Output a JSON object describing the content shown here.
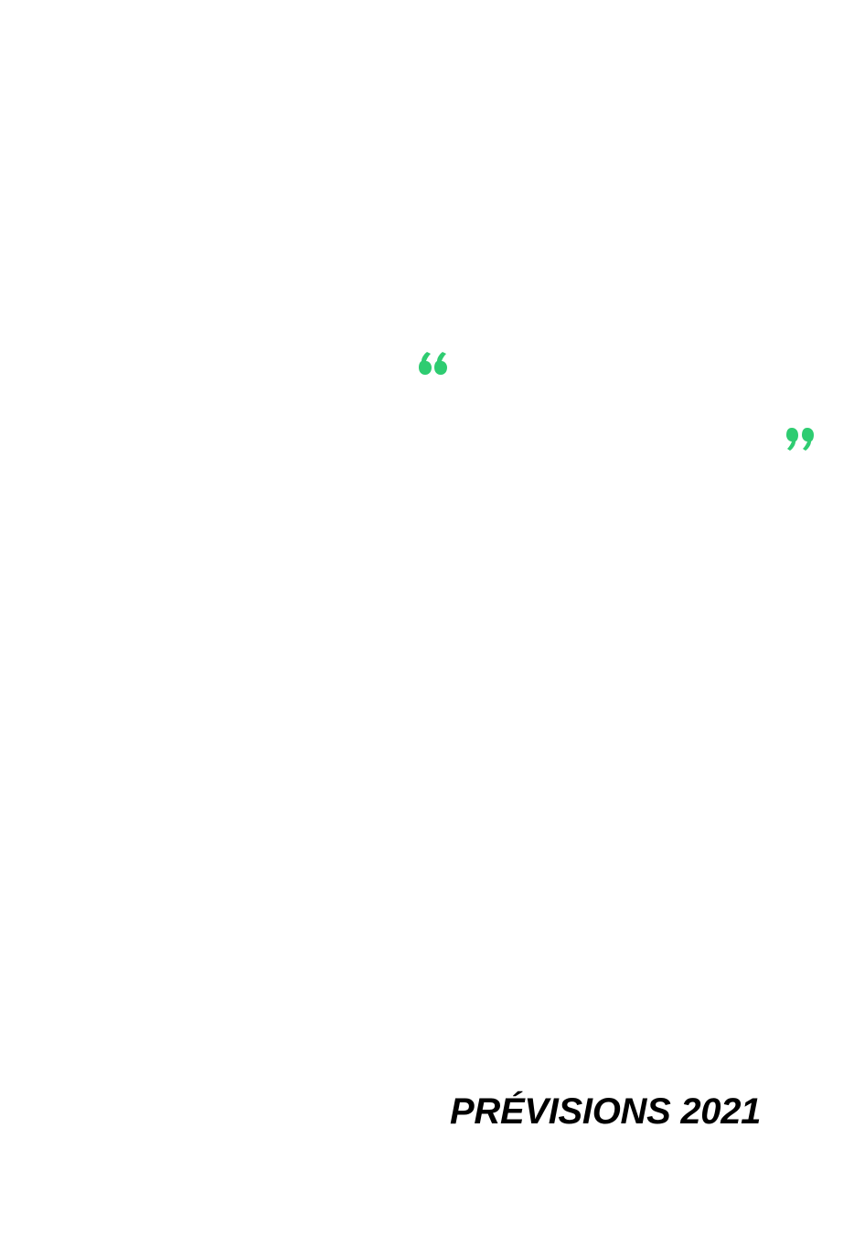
{
  "colors": {
    "accent": "#2ecc71",
    "text": "#000000",
    "background": "#ffffff"
  },
  "icons": {
    "open_quote": "open-quote-icon",
    "close_quote": "close-quote-icon"
  },
  "footer": {
    "title": "PRÉVISIONS 2021"
  }
}
